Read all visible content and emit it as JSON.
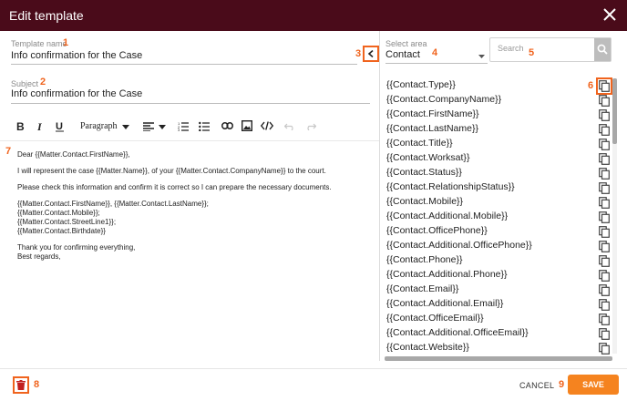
{
  "dialog": {
    "title": "Edit template"
  },
  "template_name": {
    "label": "Template name",
    "value": "Info confirmation for the Case"
  },
  "subject": {
    "label": "Subject",
    "value": "Info confirmation for the Case"
  },
  "toolbar": {
    "paragraph_label": "Paragraph"
  },
  "editor": {
    "paragraphs": [
      "Dear {{Matter.Contact.FirstName}},",
      "I will represent the case {{Matter.Name}}, of your {{Matter.Contact.CompanyName}} to the court.",
      "Please check this information and confirm it is correct so I can prepare the necessary documents.",
      "{{Matter.Contact.FirstName}}, {{Matter.Contact.LastName}};\n{{Matter.Contact.Mobile}};\n{{Matter.Contact.StreetLine1}};\n{{Matter.Contact.Birthdate}}",
      "Thank you for confirming everything,\nBest regards,"
    ]
  },
  "area": {
    "label": "Select area",
    "value": "Contact"
  },
  "search": {
    "placeholder": "Search",
    "value": ""
  },
  "fields": [
    "{{Contact.Type}}",
    "{{Contact.CompanyName}}",
    "{{Contact.FirstName}}",
    "{{Contact.LastName}}",
    "{{Contact.Title}}",
    "{{Contact.Worksat}}",
    "{{Contact.Status}}",
    "{{Contact.RelationshipStatus}}",
    "{{Contact.Mobile}}",
    "{{Contact.Additional.Mobile}}",
    "{{Contact.OfficePhone}}",
    "{{Contact.Additional.OfficePhone}}",
    "{{Contact.Phone}}",
    "{{Contact.Additional.Phone}}",
    "{{Contact.Email}}",
    "{{Contact.Additional.Email}}",
    "{{Contact.OfficeEmail}}",
    "{{Contact.Additional.OfficeEmail}}",
    "{{Contact.Website}}"
  ],
  "footer": {
    "cancel_label": "CANCEL",
    "save_label": "SAVE"
  },
  "annotations": {
    "n1": "1",
    "n2": "2",
    "n3": "3",
    "n4": "4",
    "n5": "5",
    "n6": "6",
    "n7": "7",
    "n8": "8",
    "n9": "9"
  },
  "colors": {
    "titlebar": "#4a0b1a",
    "accent": "#f0641e",
    "save": "#f5831f"
  }
}
